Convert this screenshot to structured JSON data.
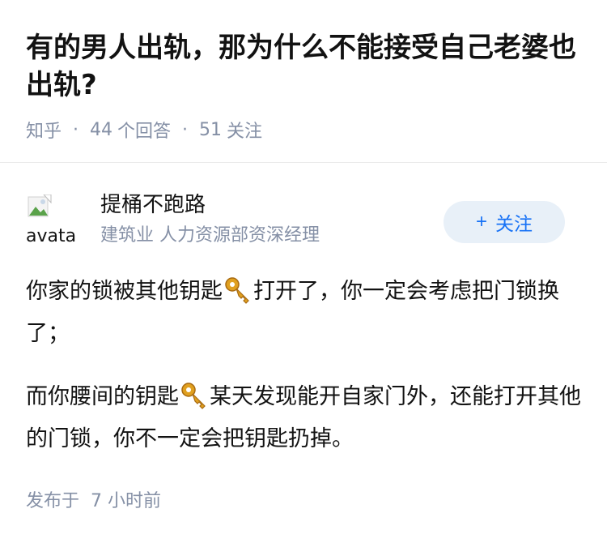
{
  "question": {
    "title": "有的男人出轨，那为什么不能接受自己老婆也出轨?",
    "source": "知乎",
    "answer_count": "44",
    "answer_unit": "个回答",
    "follow_count": "51",
    "follow_unit": "关注"
  },
  "author": {
    "avatar_alt": "avatar",
    "name": "提桶不跑路",
    "bio": "建筑业 人力资源部资深经理",
    "follow_label": "关注"
  },
  "answer": {
    "p1_before": "你家的锁被其他钥匙",
    "p1_after": "打开了，你一定会考虑把门锁换了；",
    "p2_before": "而你腰间的钥匙",
    "p2_after": "某天发现能开自家门外，还能打开其他的门锁，你不一定会把钥匙扔掉。",
    "icon": "key-icon"
  },
  "footer": {
    "published_label": "发布于",
    "time_ago": "7 小时前"
  }
}
